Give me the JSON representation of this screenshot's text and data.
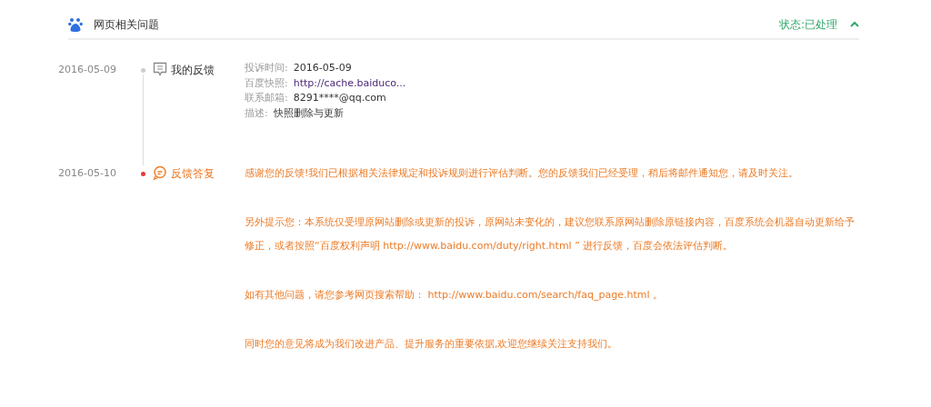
{
  "header": {
    "title": "网页相关问题",
    "status": "状态:已处理",
    "expanded": true
  },
  "timeline": [
    {
      "kind": "feedback",
      "date": "2016-05-09",
      "label": "我的反馈",
      "fields": [
        {
          "label": "投诉时间:",
          "value": "2016-05-09",
          "link": false
        },
        {
          "label": "百度快照:",
          "value": "http://cache.baiduco...",
          "link": true
        },
        {
          "label": "联系邮箱:",
          "value": "8291****@qq.com",
          "link": false
        },
        {
          "label": "描述:",
          "value": "快照删除与更新",
          "link": false
        }
      ]
    },
    {
      "kind": "reply",
      "date": "2016-05-10",
      "label": "反馈答复",
      "paragraphs": [
        "感谢您的反馈!我们已根据相关法律规定和投诉规则进行评估判断。您的反馈我们已经受理，稍后将邮件通知您，请及时关注。",
        "另外提示您：本系统仅受理原网站删除或更新的投诉，原网站未变化的，建议您联系原网站删除原链接内容，百度系统会机器自动更新给予修正，或者按照“百度权利声明 http://www.baidu.com/duty/right.html ” 进行反馈，百度会依法评估判断。",
        "如有其他问题，请您参考网页搜索帮助： http://www.baidu.com/search/faq_page.html 。",
        "同时您的意见将成为我们改进产品、提升服务的重要依据,欢迎您继续关注支持我们。"
      ]
    }
  ]
}
